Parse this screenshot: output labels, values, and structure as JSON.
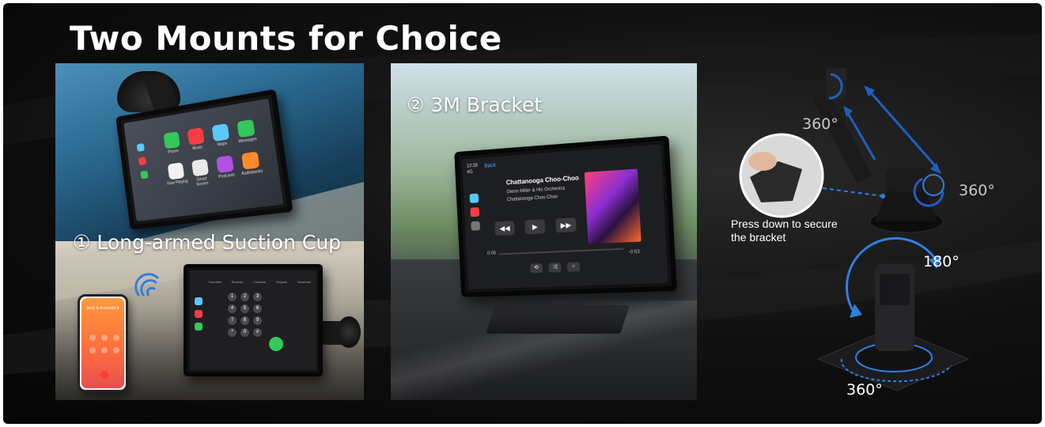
{
  "title": "Two Mounts for Choice",
  "mount_options": [
    {
      "label": "① Long-armed Suction Cup"
    },
    {
      "label": "② 3M Bracket"
    }
  ],
  "caption": {
    "press_line1": "Press down to secure",
    "press_line2": "the bracket"
  },
  "rotation_labels": {
    "arm_top": "360°",
    "arm_side": "360°",
    "bracket_top": "180°",
    "bracket_base": "360°"
  },
  "carplay_home_icons": [
    {
      "label": "Phone",
      "color": "#34c759"
    },
    {
      "label": "Music",
      "color": "#fc3c44"
    },
    {
      "label": "Maps",
      "color": "#5ac8fa"
    },
    {
      "label": "Messages",
      "color": "#34c759"
    },
    {
      "label": "Now Playing",
      "color": "#f2f2f2"
    },
    {
      "label": "Smart Screen",
      "color": "#e9e9e9"
    },
    {
      "label": "Podcasts",
      "color": "#b150e2"
    },
    {
      "label": "Audiobooks",
      "color": "#ff8a2a"
    }
  ],
  "carplay_phone_tabs": [
    "Favorites",
    "Recents",
    "Contacts",
    "Keypad",
    "Voicemail"
  ],
  "keypad_keys": [
    "1",
    "2",
    "3",
    "4",
    "5",
    "6",
    "7",
    "8",
    "9",
    "*",
    "0",
    "#"
  ],
  "phone_caller": "Jane & Armando &",
  "now_playing": {
    "status_time": "12:28",
    "status_signal": "4G",
    "back_label": "Back",
    "song_title": "Chattanooga Choo-Choo",
    "artist": "Glenn Miller & His Orchestra",
    "album": "Chattanooga Choo Choo",
    "time_elapsed": "0:06",
    "time_remaining": "-0:53"
  },
  "colors": {
    "accent_blue": "#2f7fe0",
    "arrow_blue": "#1f5fbf",
    "title_white": "#ffffff"
  }
}
